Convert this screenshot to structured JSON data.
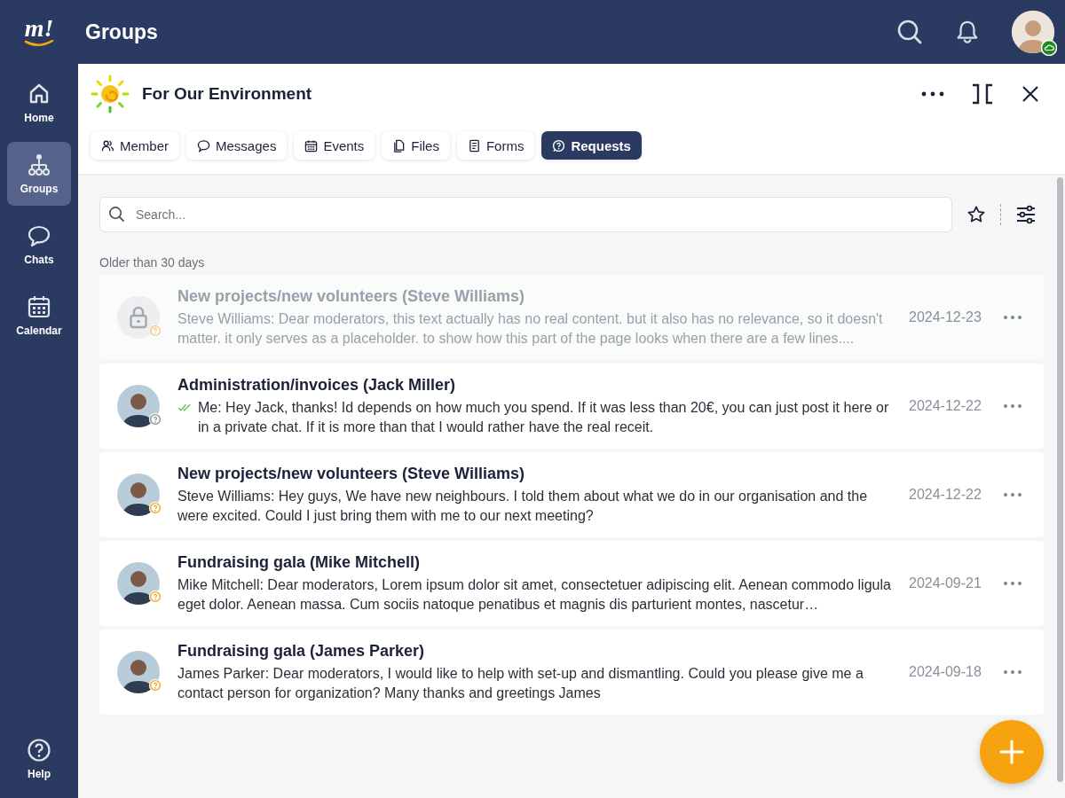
{
  "app": {
    "logo_text": "m!",
    "title": "Groups"
  },
  "sidebar": {
    "items": [
      {
        "label": "Home",
        "selected": false
      },
      {
        "label": "Groups",
        "selected": true
      },
      {
        "label": "Chats",
        "selected": false
      },
      {
        "label": "Calendar",
        "selected": false
      }
    ],
    "help": {
      "label": "Help"
    }
  },
  "group": {
    "name": "For Our Environment"
  },
  "tabs": [
    {
      "label": "Member",
      "selected": false
    },
    {
      "label": "Messages",
      "selected": false
    },
    {
      "label": "Events",
      "selected": false
    },
    {
      "label": "Files",
      "selected": false
    },
    {
      "label": "Forms",
      "selected": false
    },
    {
      "label": "Requests",
      "selected": true
    }
  ],
  "search": {
    "placeholder": "Search..."
  },
  "section_label": "Older than 30 days",
  "requests": [
    {
      "title": "New projects/new volunteers (Steve Williams)",
      "message": "Steve Williams: Dear moderators, this text actually has no real content. but it also has no relevance, so it doesn't matter. it only serves as a placeholder. to show how this part of the page looks when there are a few lines....",
      "date": "2024-12-23",
      "locked": true,
      "read_receipt": false,
      "answered": false
    },
    {
      "title": "Administration/invoices (Jack Miller)",
      "message": "Me: Hey Jack, thanks! Id depends on how much you spend. If it was less than 20€, you can just post it here or in a private chat. If it is more than that I would rather have the real receit.",
      "date": "2024-12-22",
      "locked": false,
      "read_receipt": true,
      "answered": true
    },
    {
      "title": "New projects/new volunteers (Steve Williams)",
      "message": "Steve Williams: Hey guys, We have new neighbours. I told them about what we do in our organisation and the were excited. Could I just bring them with me to our next meeting?",
      "date": "2024-12-22",
      "locked": false,
      "read_receipt": false,
      "answered": false
    },
    {
      "title": "Fundraising gala (Mike Mitchell)",
      "message": "Mike Mitchell: Dear moderators, Lorem ipsum dolor sit amet, consectetuer adipiscing elit. Aenean commodo ligula eget dolor. Aenean massa. Cum sociis natoque penatibus et magnis dis parturient montes, nascetur…",
      "date": "2024-09-21",
      "locked": false,
      "read_receipt": false,
      "answered": false
    },
    {
      "title": "Fundraising gala (James Parker)",
      "message": "James Parker: Dear moderators, I would like to help with set-up and dismantling. Could you please give me a contact person for organization? Many thanks and greetings James",
      "date": "2024-09-18",
      "locked": false,
      "read_receipt": false,
      "answered": false
    }
  ]
}
